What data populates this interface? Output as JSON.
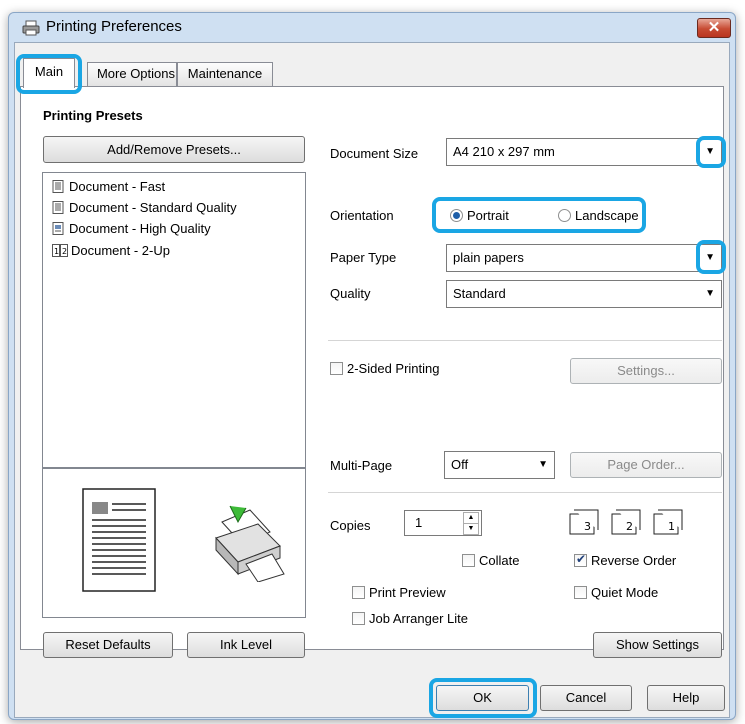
{
  "window": {
    "title": "Printing Preferences",
    "close_glyph": "✕"
  },
  "tabs": [
    "Main",
    "More Options",
    "Maintenance"
  ],
  "presets": {
    "heading": "Printing Presets",
    "add_remove": "Add/Remove Presets...",
    "items": [
      "Document - Fast",
      "Document - Standard Quality",
      "Document - High Quality",
      "Document - 2-Up"
    ]
  },
  "document_size": {
    "label": "Document Size",
    "value": "A4 210 x 297 mm"
  },
  "orientation": {
    "label": "Orientation",
    "portrait": "Portrait",
    "landscape": "Landscape",
    "selected": "Portrait"
  },
  "paper_type": {
    "label": "Paper Type",
    "value": "plain papers"
  },
  "quality": {
    "label": "Quality",
    "value": "Standard"
  },
  "two_sided": {
    "label": "2-Sided Printing",
    "settings": "Settings..."
  },
  "multi_page": {
    "label": "Multi-Page",
    "value": "Off",
    "page_order": "Page Order..."
  },
  "copies": {
    "label": "Copies",
    "value": "1",
    "collate": "Collate",
    "reverse_order": "Reverse Order",
    "reverse_checked": true
  },
  "options": {
    "print_preview": "Print Preview",
    "quiet_mode": "Quiet Mode",
    "job_arranger": "Job Arranger Lite"
  },
  "buttons": {
    "reset": "Reset Defaults",
    "ink": "Ink Level",
    "show_settings": "Show Settings",
    "ok": "OK",
    "cancel": "Cancel",
    "help": "Help"
  },
  "accent": "#1aa6e4"
}
